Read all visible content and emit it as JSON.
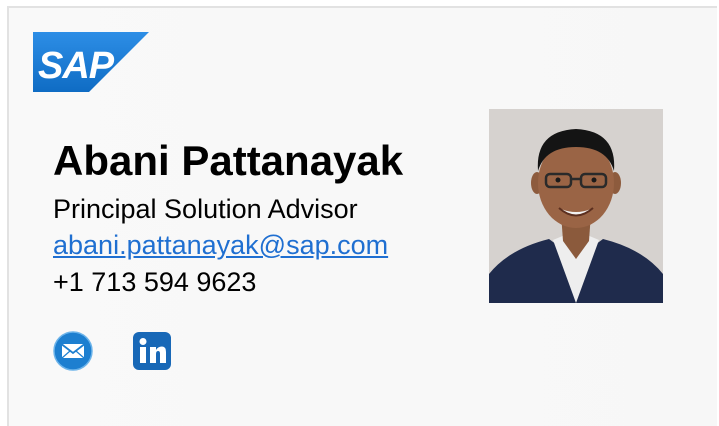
{
  "logo": {
    "text": "SAP",
    "colors": {
      "background": "#1a7bd5",
      "text": "#ffffff"
    }
  },
  "contact": {
    "name": "Abani Pattanayak",
    "title": "Principal Solution Advisor",
    "email": "abani.pattanayak@sap.com",
    "phone": "+1 713 594 9623"
  },
  "social_icons": [
    {
      "icon": "email-icon",
      "color": "#1d7fd0"
    },
    {
      "icon": "linkedin-icon",
      "color": "#1868b7"
    }
  ],
  "colors": {
    "link": "#1f6fd1",
    "photo_background": "#d9d5d2",
    "jacket": "#1f2b4c"
  }
}
